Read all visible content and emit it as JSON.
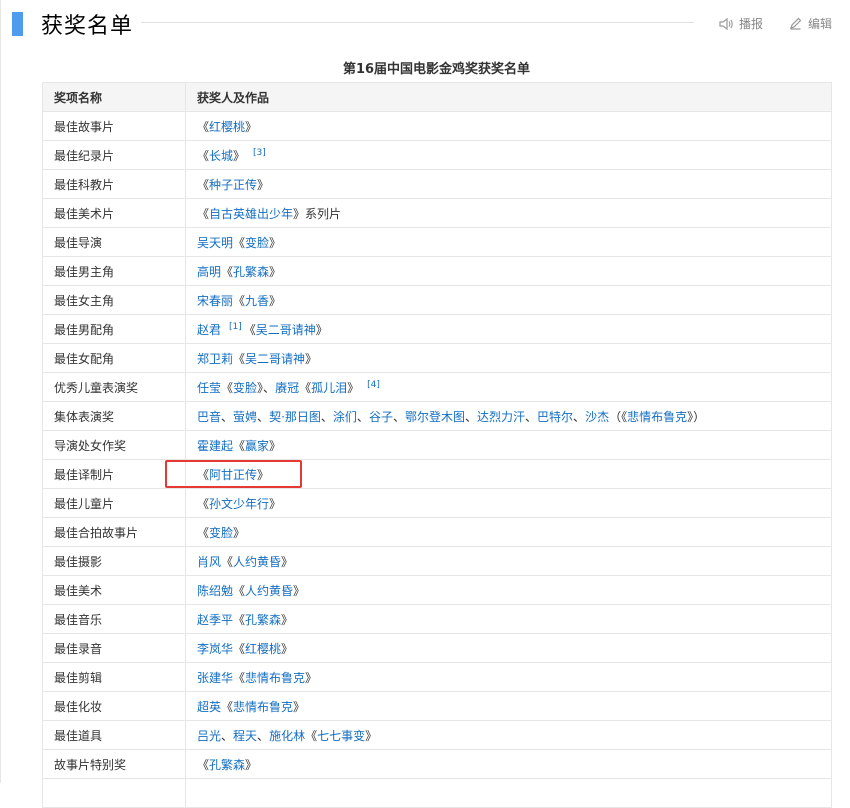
{
  "header": {
    "title": "获奖名单",
    "broadcast_label": "播报",
    "edit_label": "编辑"
  },
  "table": {
    "caption": "第16届中国电影金鸡奖获奖名单",
    "columns": [
      "奖项名称",
      "获奖人及作品"
    ],
    "rows": [
      {
        "award": "最佳故事片",
        "parts": [
          {
            "t": "《"
          },
          {
            "t": "红樱桃",
            "link": true
          },
          {
            "t": "》"
          }
        ]
      },
      {
        "award": "最佳纪录片",
        "parts": [
          {
            "t": "《"
          },
          {
            "t": "长城",
            "link": true
          },
          {
            "t": "》"
          },
          {
            "t": "[3]",
            "sup": true
          }
        ]
      },
      {
        "award": "最佳科教片",
        "parts": [
          {
            "t": "《"
          },
          {
            "t": "种子正传",
            "link": true
          },
          {
            "t": "》"
          }
        ]
      },
      {
        "award": "最佳美术片",
        "parts": [
          {
            "t": "《"
          },
          {
            "t": "自古英雄出少年",
            "link": true
          },
          {
            "t": "》系列片",
            "plain": true
          }
        ]
      },
      {
        "award": "最佳导演",
        "parts": [
          {
            "t": "吴天明",
            "link": true
          },
          {
            "t": "《"
          },
          {
            "t": "变脸",
            "link": true
          },
          {
            "t": "》"
          }
        ]
      },
      {
        "award": "最佳男主角",
        "parts": [
          {
            "t": "高明",
            "link": true
          },
          {
            "t": "《"
          },
          {
            "t": "孔繁森",
            "link": true
          },
          {
            "t": "》"
          }
        ]
      },
      {
        "award": "最佳女主角",
        "parts": [
          {
            "t": "宋春丽",
            "link": true
          },
          {
            "t": "《"
          },
          {
            "t": "九香",
            "link": true
          },
          {
            "t": "》"
          }
        ]
      },
      {
        "award": "最佳男配角",
        "parts": [
          {
            "t": "赵君",
            "link": true
          },
          {
            "t": "[1]",
            "sup": true
          },
          {
            "t": "《"
          },
          {
            "t": "吴二哥请神",
            "link": true
          },
          {
            "t": "》"
          }
        ]
      },
      {
        "award": "最佳女配角",
        "parts": [
          {
            "t": "郑卫莉",
            "link": true
          },
          {
            "t": "《"
          },
          {
            "t": "吴二哥请神",
            "link": true
          },
          {
            "t": "》"
          }
        ]
      },
      {
        "award": "优秀儿童表演奖",
        "parts": [
          {
            "t": "任莹",
            "link": true
          },
          {
            "t": "《"
          },
          {
            "t": "变脸",
            "link": true
          },
          {
            "t": "》、"
          },
          {
            "t": "赓冠",
            "link": true
          },
          {
            "t": "《"
          },
          {
            "t": "孤儿泪",
            "link": true
          },
          {
            "t": "》"
          },
          {
            "t": "[4]",
            "sup": true
          }
        ]
      },
      {
        "award": "集体表演奖",
        "parts": [
          {
            "t": "巴音",
            "link": true
          },
          {
            "t": "、"
          },
          {
            "t": "萤娉",
            "link": true
          },
          {
            "t": "、"
          },
          {
            "t": "契·那日图",
            "link": true
          },
          {
            "t": "、"
          },
          {
            "t": "涂们",
            "link": true
          },
          {
            "t": "、"
          },
          {
            "t": "谷子",
            "link": true
          },
          {
            "t": "、"
          },
          {
            "t": "鄂尔登木图",
            "link": true
          },
          {
            "t": "、"
          },
          {
            "t": "达烈力汗",
            "link": true
          },
          {
            "t": "、"
          },
          {
            "t": "巴特尔",
            "link": true
          },
          {
            "t": "、"
          },
          {
            "t": "沙杰",
            "link": true
          },
          {
            "t": "（《"
          },
          {
            "t": "悲情布鲁克",
            "link": true
          },
          {
            "t": "》）"
          }
        ]
      },
      {
        "award": "导演处女作奖",
        "parts": [
          {
            "t": "霍建起",
            "link": true
          },
          {
            "t": "《"
          },
          {
            "t": "赢家",
            "link": true
          },
          {
            "t": "》"
          }
        ]
      },
      {
        "award": "最佳译制片",
        "parts": [
          {
            "t": "《"
          },
          {
            "t": "阿甘正传",
            "link": true
          },
          {
            "t": "》"
          }
        ]
      },
      {
        "award": "最佳儿童片",
        "parts": [
          {
            "t": "《"
          },
          {
            "t": "孙文少年行",
            "link": true
          },
          {
            "t": "》"
          }
        ]
      },
      {
        "award": "最佳合拍故事片",
        "parts": [
          {
            "t": "《"
          },
          {
            "t": "变脸",
            "link": true
          },
          {
            "t": "》"
          }
        ]
      },
      {
        "award": "最佳摄影",
        "parts": [
          {
            "t": "肖风",
            "link": true
          },
          {
            "t": "《"
          },
          {
            "t": "人约黄昏",
            "link": true
          },
          {
            "t": "》"
          }
        ]
      },
      {
        "award": "最佳美术",
        "parts": [
          {
            "t": "陈绍勉",
            "link": true
          },
          {
            "t": "《"
          },
          {
            "t": "人约黄昏",
            "link": true
          },
          {
            "t": "》"
          }
        ]
      },
      {
        "award": "最佳音乐",
        "parts": [
          {
            "t": "赵季平",
            "link": true
          },
          {
            "t": "《"
          },
          {
            "t": "孔繁森",
            "link": true
          },
          {
            "t": "》"
          }
        ]
      },
      {
        "award": "最佳录音",
        "parts": [
          {
            "t": "李岚华",
            "link": true
          },
          {
            "t": "《"
          },
          {
            "t": "红樱桃",
            "link": true
          },
          {
            "t": "》"
          }
        ]
      },
      {
        "award": "最佳剪辑",
        "parts": [
          {
            "t": "张建华",
            "link": true
          },
          {
            "t": "《"
          },
          {
            "t": "悲情布鲁克",
            "link": true
          },
          {
            "t": "》"
          }
        ]
      },
      {
        "award": "最佳化妆",
        "parts": [
          {
            "t": "超英",
            "link": true
          },
          {
            "t": "《"
          },
          {
            "t": "悲情布鲁克",
            "link": true
          },
          {
            "t": "》"
          }
        ]
      },
      {
        "award": "最佳道具",
        "parts": [
          {
            "t": "吕光",
            "link": true
          },
          {
            "t": "、"
          },
          {
            "t": "程天",
            "link": true
          },
          {
            "t": "、"
          },
          {
            "t": "施化林",
            "link": true
          },
          {
            "t": "《"
          },
          {
            "t": "七七事变",
            "link": true
          },
          {
            "t": "》"
          }
        ]
      },
      {
        "award": "故事片特别奖",
        "parts": [
          {
            "t": "《"
          },
          {
            "t": "孔繁森",
            "link": true
          },
          {
            "t": "》"
          }
        ]
      },
      {
        "award": "",
        "parts": []
      }
    ]
  },
  "colors": {
    "accent": "#4f9cee",
    "link": "#136ec2",
    "highlight": "#e53935"
  }
}
